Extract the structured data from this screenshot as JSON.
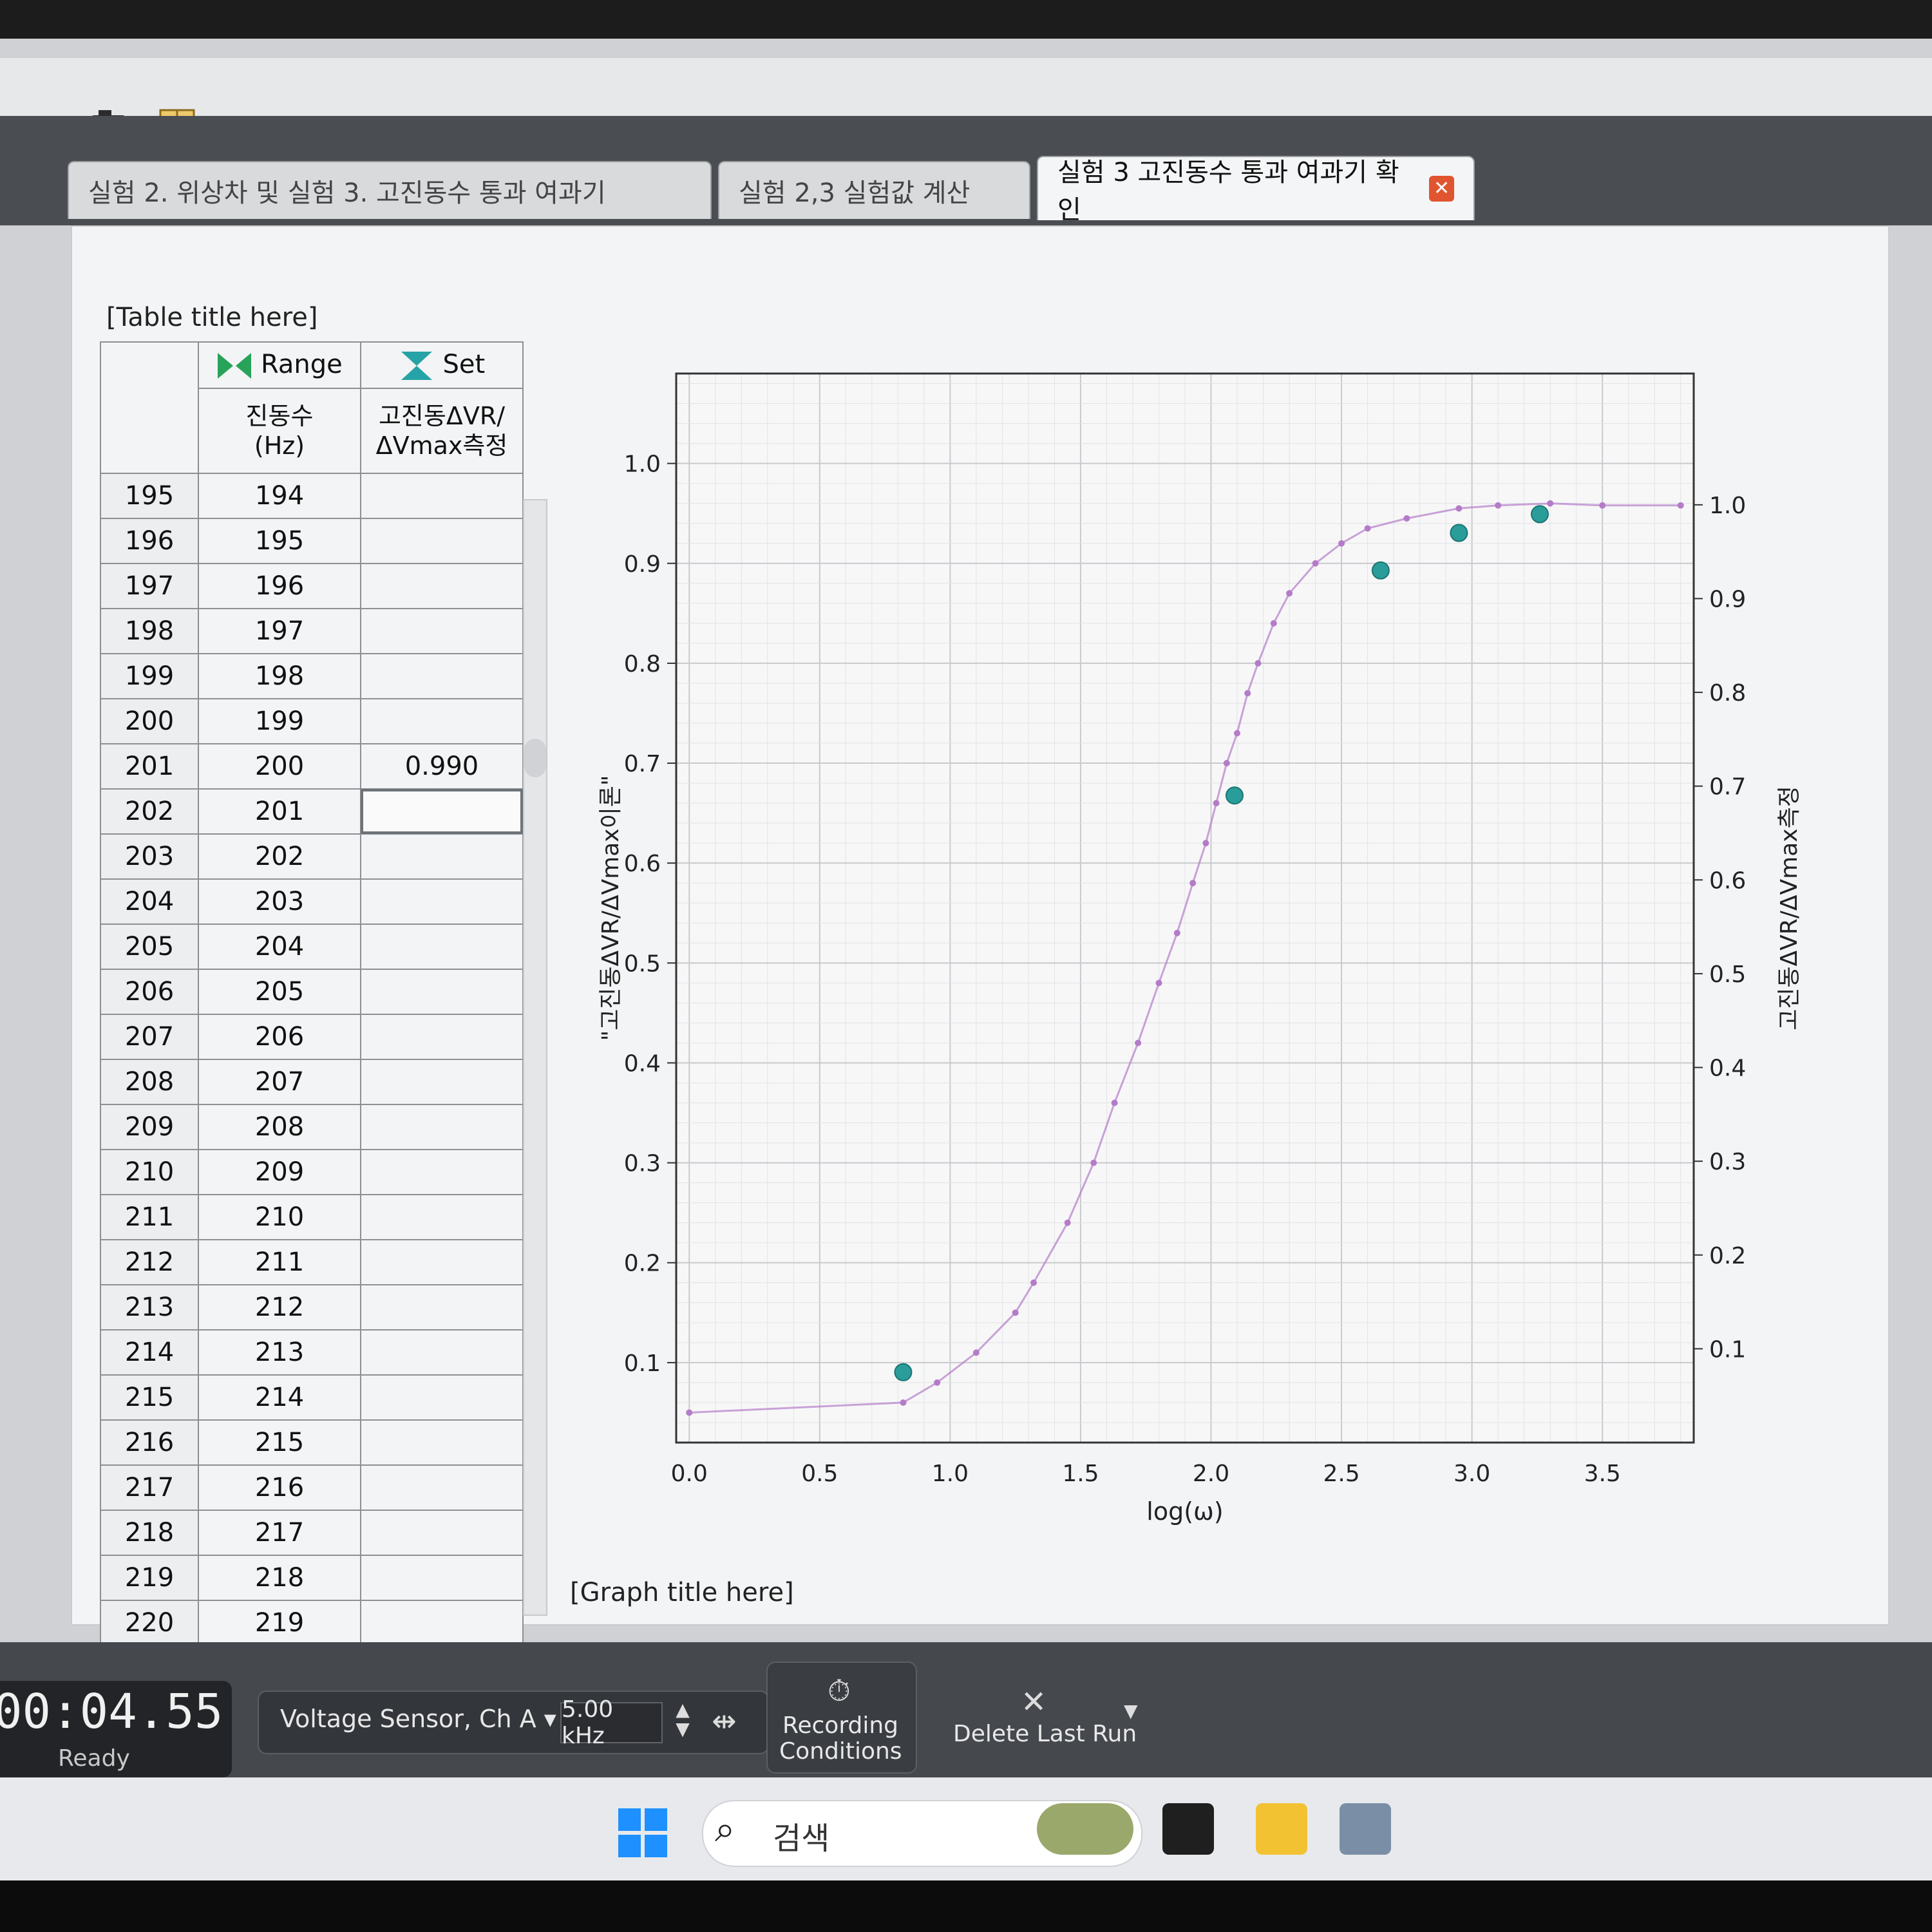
{
  "toolbar": {
    "camera_label": "▾"
  },
  "tabs": [
    {
      "label": "실험 2. 위상차 및 실험 3. 고진동수 통과 여과기"
    },
    {
      "label": "실험 2,3 실험값 계산"
    },
    {
      "label": "실험 3 고진동수 통과 여과기 확인",
      "close": "✕"
    }
  ],
  "table": {
    "title": "[Table title here]",
    "col1_group": "Range",
    "col2_group": "Set",
    "col1_header_line1": "진동수",
    "col1_header_line2": "(Hz)",
    "col2_header_line1": "고진동ΔVR/",
    "col2_header_line2": "ΔVmax측정",
    "rows": [
      {
        "n": "195",
        "f": "194",
        "v": ""
      },
      {
        "n": "196",
        "f": "195",
        "v": ""
      },
      {
        "n": "197",
        "f": "196",
        "v": ""
      },
      {
        "n": "198",
        "f": "197",
        "v": ""
      },
      {
        "n": "199",
        "f": "198",
        "v": ""
      },
      {
        "n": "200",
        "f": "199",
        "v": ""
      },
      {
        "n": "201",
        "f": "200",
        "v": "0.990"
      },
      {
        "n": "202",
        "f": "201",
        "v": ""
      },
      {
        "n": "203",
        "f": "202",
        "v": ""
      },
      {
        "n": "204",
        "f": "203",
        "v": ""
      },
      {
        "n": "205",
        "f": "204",
        "v": ""
      },
      {
        "n": "206",
        "f": "205",
        "v": ""
      },
      {
        "n": "207",
        "f": "206",
        "v": ""
      },
      {
        "n": "208",
        "f": "207",
        "v": ""
      },
      {
        "n": "209",
        "f": "208",
        "v": ""
      },
      {
        "n": "210",
        "f": "209",
        "v": ""
      },
      {
        "n": "211",
        "f": "210",
        "v": ""
      },
      {
        "n": "212",
        "f": "211",
        "v": ""
      },
      {
        "n": "213",
        "f": "212",
        "v": ""
      },
      {
        "n": "214",
        "f": "213",
        "v": ""
      },
      {
        "n": "215",
        "f": "214",
        "v": ""
      },
      {
        "n": "216",
        "f": "215",
        "v": ""
      },
      {
        "n": "217",
        "f": "216",
        "v": ""
      },
      {
        "n": "218",
        "f": "217",
        "v": ""
      },
      {
        "n": "219",
        "f": "218",
        "v": ""
      },
      {
        "n": "220",
        "f": "219",
        "v": ""
      }
    ]
  },
  "graph": {
    "title": "[Graph title here]"
  },
  "chart_data": {
    "type": "scatter",
    "xlabel": "log(ω)",
    "ylabel_left": "\"고진동ΔVR/ΔVmax이론\"",
    "ylabel_right": "고진동ΔVR/ΔVmax측정",
    "xlim": [
      -0.05,
      3.85
    ],
    "ylim_left": [
      0.02,
      1.09
    ],
    "ylim_right": [
      0.0,
      1.14
    ],
    "x_ticks": [
      "0.0",
      "0.5",
      "1.0",
      "1.5",
      "2.0",
      "2.5",
      "3.0",
      "3.5"
    ],
    "y_ticks_left": [
      "0.1",
      "0.2",
      "0.3",
      "0.4",
      "0.5",
      "0.6",
      "0.7",
      "0.8",
      "0.9",
      "1.0"
    ],
    "y_ticks_right": [
      "0.1",
      "0.2",
      "0.3",
      "0.4",
      "0.5",
      "0.6",
      "0.7",
      "0.8",
      "0.9",
      "1.0"
    ],
    "grid": true,
    "series": [
      {
        "axis": "left",
        "color": "#b47cc8",
        "points": [
          [
            0.0,
            0.05
          ],
          [
            0.82,
            0.06
          ],
          [
            0.95,
            0.08
          ],
          [
            1.1,
            0.11
          ],
          [
            1.25,
            0.15
          ],
          [
            1.32,
            0.18
          ],
          [
            1.45,
            0.24
          ],
          [
            1.55,
            0.3
          ],
          [
            1.63,
            0.36
          ],
          [
            1.72,
            0.42
          ],
          [
            1.8,
            0.48
          ],
          [
            1.87,
            0.53
          ],
          [
            1.93,
            0.58
          ],
          [
            1.98,
            0.62
          ],
          [
            2.02,
            0.66
          ],
          [
            2.06,
            0.7
          ],
          [
            2.1,
            0.73
          ],
          [
            2.14,
            0.77
          ],
          [
            2.18,
            0.8
          ],
          [
            2.24,
            0.84
          ],
          [
            2.3,
            0.87
          ],
          [
            2.4,
            0.9
          ],
          [
            2.5,
            0.92
          ],
          [
            2.6,
            0.935
          ],
          [
            2.75,
            0.945
          ],
          [
            2.95,
            0.955
          ],
          [
            3.1,
            0.958
          ],
          [
            3.3,
            0.96
          ],
          [
            3.5,
            0.958
          ],
          [
            3.8,
            0.958
          ]
        ]
      },
      {
        "axis": "right",
        "color": "#2a9d9a",
        "points": [
          [
            0.82,
            0.075
          ],
          [
            2.09,
            0.69
          ],
          [
            2.65,
            0.93
          ],
          [
            2.95,
            0.97
          ],
          [
            3.26,
            0.99
          ]
        ]
      }
    ]
  },
  "status": {
    "timer": "00:04.55",
    "state": "Ready"
  },
  "controls": {
    "sensor": "Voltage Sensor, Ch A ▾",
    "rate": "5.00 kHz",
    "recording": "Recording Conditions",
    "delete": "Delete Last Run"
  },
  "taskbar": {
    "search": "검색"
  }
}
